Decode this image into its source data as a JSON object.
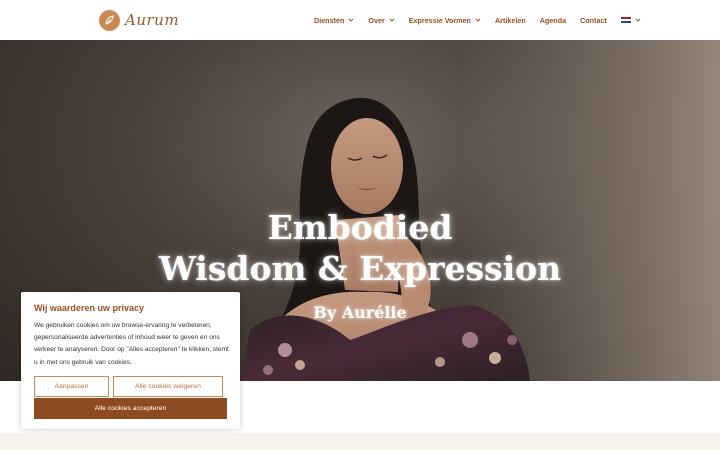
{
  "brand": {
    "name": "Aurum",
    "accent": "#9a4f22",
    "logo_bg": "#c98a55"
  },
  "nav": {
    "items": [
      {
        "label": "Diensten",
        "has_dropdown": true
      },
      {
        "label": "Over",
        "has_dropdown": true
      },
      {
        "label": "Expressie Vormen",
        "has_dropdown": true
      },
      {
        "label": "Artikelen",
        "has_dropdown": false
      },
      {
        "label": "Agenda",
        "has_dropdown": false
      },
      {
        "label": "Contact",
        "has_dropdown": false
      }
    ],
    "language_icon": "netherlands-flag-icon"
  },
  "hero": {
    "line1": "Embodied",
    "line2": "Wisdom & Expression",
    "byline": "By Aurélie"
  },
  "cookie": {
    "title": "Wij waarderen uw privacy",
    "body": "We gebruiken cookies om uw browse-ervaring te verbeteren, gepersonaliseerde advertenties of inhoud weer te geven en ons verkeer te analyseren. Door op \"Alles accepteren\" te klikken, stemt u in met ons gebruik van cookies.",
    "customize_label": "Aanpassen",
    "reject_label": "Alle cookies weigeren",
    "accept_label": "Alle cookies accepteren"
  }
}
